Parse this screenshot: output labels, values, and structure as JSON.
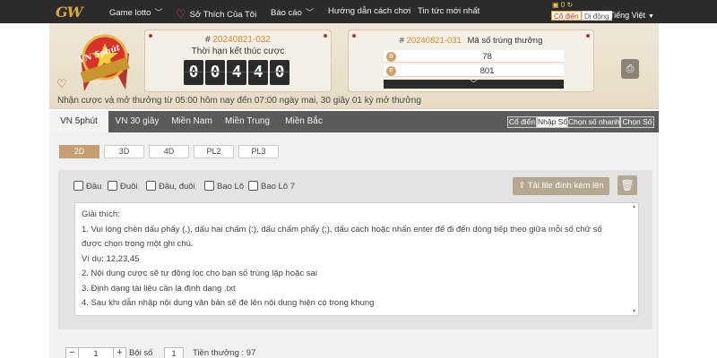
{
  "nav": {
    "logo": "GW",
    "items": [
      {
        "label": "Game lotto",
        "dropdown": true
      },
      {
        "label": "Sở Thích Của Tôi",
        "dropdown": false
      },
      {
        "label": "Báo cáo",
        "dropdown": true
      },
      {
        "label": "Hướng dẫn cách chơi",
        "dropdown": false
      },
      {
        "label": "Tin tức mới nhất",
        "dropdown": false
      }
    ],
    "balance": "0",
    "mode_classic": "Cổ điển",
    "mode_mobile": "Di động",
    "language": "Tiếng Việt"
  },
  "banner": {
    "badge_label": "VN 5phút",
    "current_draw": {
      "prefix": "#",
      "id": "20240821-032"
    },
    "deadline_label": "Thời hạn kết thúc cược",
    "countdown": [
      "0",
      "0",
      "4",
      "4",
      "0"
    ],
    "winning": {
      "prefix": "#",
      "id": "20240821-031",
      "label": "Mã số trúng thưởng",
      "rows": [
        {
          "ball": "B",
          "value": "78"
        },
        {
          "ball": "F",
          "value": "801"
        }
      ]
    },
    "notice": "Nhận cược và mở thưởng từ 05:00 hôm nay đến 07:00 ngày mai,    30 giây 01 kỳ mở thưởng"
  },
  "game_tabs": [
    {
      "label": "VN 5phút",
      "active": true
    },
    {
      "label": "VN 30 giây",
      "active": false
    },
    {
      "label": "Miền Nam",
      "active": false
    },
    {
      "label": "Miền Trung",
      "active": false
    },
    {
      "label": "Miền Bắc",
      "active": false
    }
  ],
  "input_modes": [
    {
      "label": "Cổ điển",
      "active": false
    },
    {
      "label": "Nhập Số",
      "active": true
    },
    {
      "label": "Chọn số nhanh",
      "active": false
    },
    {
      "label": "Chọn Số",
      "active": false
    }
  ],
  "digit_tabs": [
    {
      "label": "2D",
      "active": true
    },
    {
      "label": "3D",
      "active": false
    },
    {
      "label": "4D",
      "active": false
    },
    {
      "label": "PL2",
      "active": false
    },
    {
      "label": "PL3",
      "active": false
    }
  ],
  "options": [
    "Đầu",
    "Đuôi",
    "Đầu, đuôi",
    "Bao Lô",
    "Bao Lô 7"
  ],
  "upload_label": "Tải file đính kèm lên",
  "instructions": [
    "Giải thích:",
    "1. Vui lòng chèn dấu phẩy (,), dấu hai chấm (:), dấu chấm phẩy (;), dấu cách hoặc nhấn enter để đi đến dòng tiếp theo giữa mỗi số chữ số",
    "được chọn trong một ghi chú.",
    "Ví dụ: 12,23,45",
    "2. Nội dung cược sẽ tự động lọc cho bạn số trùng lặp hoặc sai",
    "3. Định dạng tài liệu cần là định dạng .txt",
    "4. Sau khi dẫn nhập nội dung văn bản sẽ đè lên nội dung hiện có trong khung"
  ],
  "bet": {
    "minus": "−",
    "plus": "+",
    "amount": "1",
    "multiplier_label": "Bội số",
    "multiplier": "1",
    "prize_label": "Tiền thưởng :",
    "prize": "97"
  }
}
